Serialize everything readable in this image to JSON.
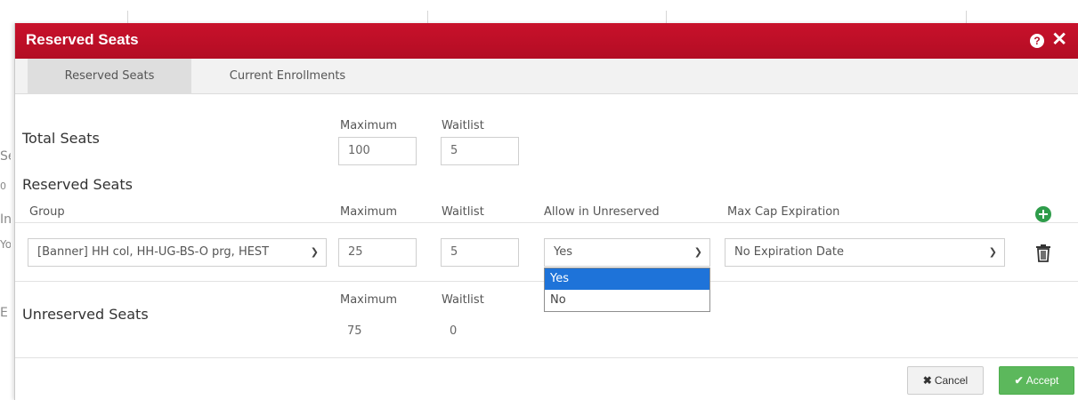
{
  "background": {
    "letters": [
      "Se",
      "0",
      "In",
      "Yo",
      "E"
    ]
  },
  "modal": {
    "title": "Reserved Seats",
    "help_icon": "?",
    "close_icon": "✕"
  },
  "tabs": [
    {
      "label": "Reserved Seats",
      "active": true
    },
    {
      "label": "Current Enrollments",
      "active": false
    }
  ],
  "total_seats": {
    "heading": "Total Seats",
    "maximum_label": "Maximum",
    "waitlist_label": "Waitlist",
    "maximum": "100",
    "waitlist": "5"
  },
  "reserved": {
    "heading": "Reserved Seats",
    "columns": {
      "group": "Group",
      "maximum": "Maximum",
      "waitlist": "Waitlist",
      "allow": "Allow in Unreserved",
      "expiration": "Max Cap Expiration"
    },
    "row": {
      "group": "[Banner] HH col, HH-UG-BS-O prg, HEST",
      "maximum": "25",
      "waitlist": "5",
      "allow": "Yes",
      "expiration": "No Expiration Date"
    },
    "allow_options": [
      "Yes",
      "No"
    ],
    "add_icon": "plus-circle-icon",
    "delete_icon": "trash-icon"
  },
  "unreserved": {
    "heading": "Unreserved Seats",
    "maximum_label": "Maximum",
    "waitlist_label": "Waitlist",
    "maximum": "75",
    "waitlist": "0"
  },
  "footer": {
    "cancel_icon": "✖",
    "cancel_label": "Cancel",
    "accept_icon": "✔",
    "accept_label": "Accept"
  },
  "colors": {
    "header": "#b30d24",
    "accept": "#5cb85c",
    "add": "#2e9c4a",
    "selected_option": "#1e73d9"
  }
}
